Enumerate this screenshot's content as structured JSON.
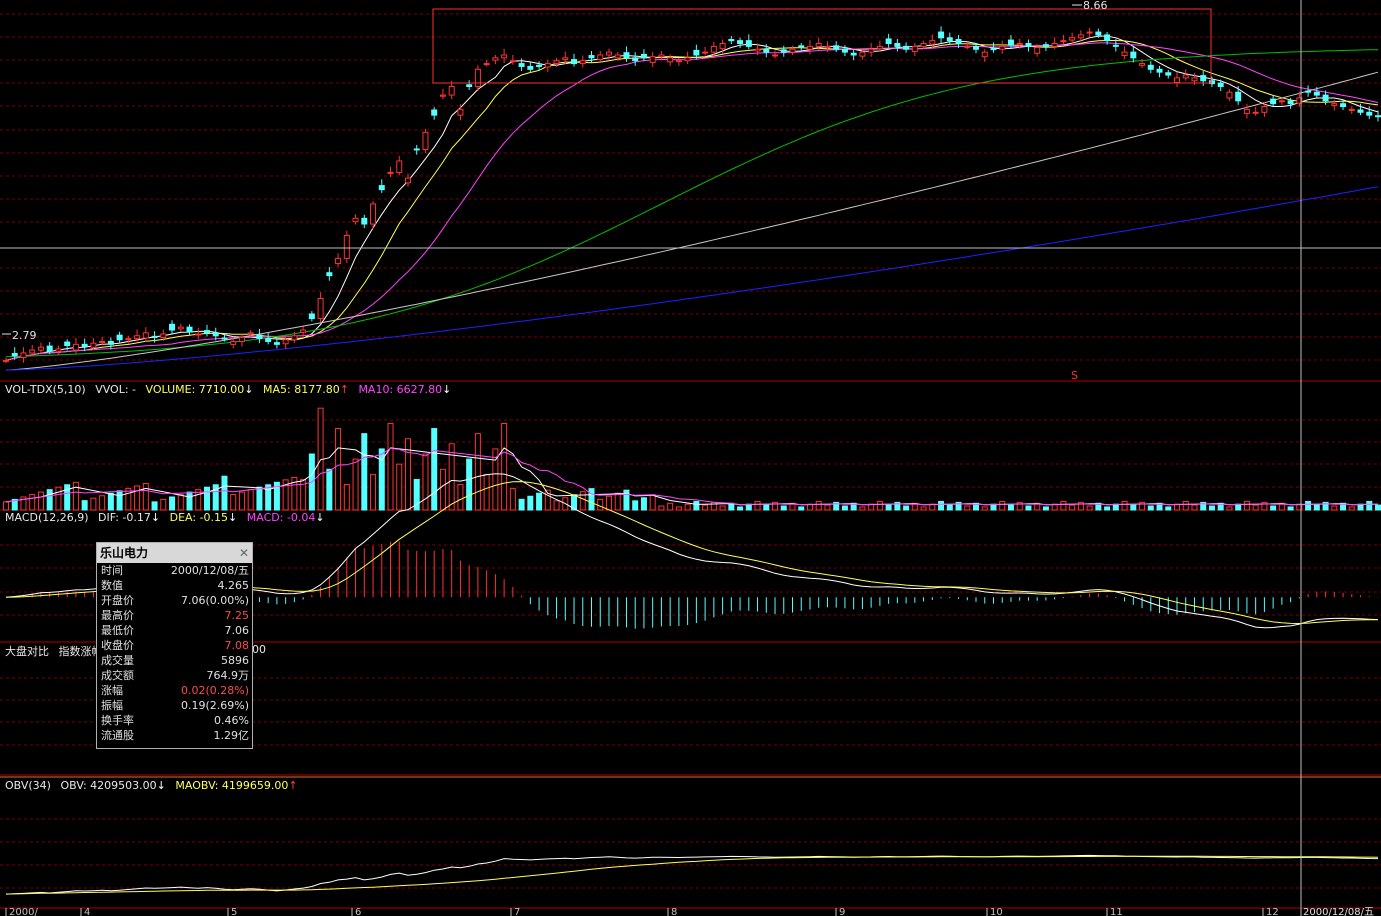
{
  "price_panel": {
    "high_label": "8.66",
    "low_label": "2.79",
    "signal_mark": "S"
  },
  "volume_header": {
    "name": "VOL-TDX(5,10)",
    "vvol": "VVOL: -",
    "volume": "VOLUME: 7710.00",
    "volume_arrow": "↓",
    "ma5": "MA5: 8177.80",
    "ma5_arrow": "↑",
    "ma10": "MA10: 6627.80",
    "ma10_arrow": "↓"
  },
  "macd_header": {
    "name": "MACD(12,26,9)",
    "dif": "DIF: -0.17",
    "dif_arrow": "↓",
    "dea": "DEA: -0.15",
    "dea_arrow": "↓",
    "macd": "MACD: -0.04",
    "macd_arrow": "↓"
  },
  "compare_header": {
    "name": "大盘对比",
    "sub": "指数涨幅",
    "value_tail": "00"
  },
  "obv_header": {
    "name": "OBV(34)",
    "obv": "OBV: 4209503.00",
    "obv_arrow": "↓",
    "maobv": "MAOBV: 4199659.00",
    "maobv_arrow": "↑"
  },
  "info_panel": {
    "title": "乐山电力",
    "close_icon": "✕",
    "rows": [
      {
        "k": "时间",
        "v": "2000/12/08/五",
        "red": false
      },
      {
        "k": "数值",
        "v": "4.265",
        "red": false
      },
      {
        "k": "开盘价",
        "v": "7.06(0.00%)",
        "red": false
      },
      {
        "k": "最高价",
        "v": "7.25",
        "red": true
      },
      {
        "k": "最低价",
        "v": "7.06",
        "red": false
      },
      {
        "k": "收盘价",
        "v": "7.08",
        "red": true
      },
      {
        "k": "成交量",
        "v": "5896",
        "red": false
      },
      {
        "k": "成交额",
        "v": "764.9万",
        "red": false
      },
      {
        "k": "涨幅",
        "v": "0.02(0.28%)",
        "red": true
      },
      {
        "k": "振幅",
        "v": "0.19(2.69%)",
        "red": false
      },
      {
        "k": "换手率",
        "v": "0.46%",
        "red": false
      },
      {
        "k": "流通股",
        "v": "1.29亿",
        "red": false
      }
    ]
  },
  "x_axis": {
    "months": [
      "2000/",
      "4",
      "5",
      "6",
      "7",
      "8",
      "9",
      "10",
      "11",
      "12"
    ],
    "cursor_date": "2000/12/08/五"
  },
  "colors": {
    "up": "#ff3232",
    "down": "#54ffff",
    "ma5": "#ffffff",
    "ma10": "#ffff54",
    "ma20": "#ff45ff",
    "ma60": "#00c000",
    "ma120": "#c8c8c8",
    "ma250": "#2020ff",
    "grid": "#7a0000",
    "separator": "#b00000"
  },
  "chart_data": {
    "type": "candlestick",
    "y_range_price": [
      2.6,
      8.9
    ],
    "high": 8.66,
    "low": 2.79,
    "closes": [
      2.82,
      2.9,
      2.95,
      3.0,
      3.05,
      2.98,
      3.02,
      3.08,
      3.1,
      3.06,
      3.12,
      3.15,
      3.1,
      3.18,
      3.2,
      3.25,
      3.3,
      3.22,
      3.28,
      3.35,
      3.4,
      3.32,
      3.28,
      3.3,
      3.25,
      3.2,
      3.15,
      3.22,
      3.3,
      3.2,
      3.15,
      3.1,
      3.18,
      3.25,
      3.35,
      3.55,
      3.9,
      4.3,
      4.6,
      5.0,
      5.3,
      5.2,
      5.55,
      5.8,
      6.1,
      6.3,
      6.0,
      6.5,
      6.8,
      7.1,
      7.45,
      7.6,
      7.2,
      7.6,
      7.9,
      8.0,
      8.1,
      8.15,
      8.05,
      7.95,
      7.9,
      7.95,
      8.0,
      8.05,
      8.1,
      8.0,
      8.05,
      8.1,
      8.15,
      8.2,
      8.15,
      8.1,
      8.05,
      8.1,
      8.12,
      8.15,
      8.1,
      8.05,
      8.1,
      8.15,
      8.2,
      8.3,
      8.35,
      8.4,
      8.35,
      8.3,
      8.25,
      8.2,
      8.15,
      8.2,
      8.25,
      8.3,
      8.3,
      8.35,
      8.3,
      8.25,
      8.2,
      8.15,
      8.2,
      8.25,
      8.3,
      8.35,
      8.3,
      8.25,
      8.3,
      8.35,
      8.4,
      8.45,
      8.4,
      8.35,
      8.3,
      8.25,
      8.2,
      8.25,
      8.3,
      8.32,
      8.35,
      8.3,
      8.28,
      8.3,
      8.35,
      8.4,
      8.45,
      8.5,
      8.55,
      8.5,
      8.4,
      8.3,
      8.2,
      8.1,
      8.0,
      7.9,
      7.85,
      7.8,
      7.75,
      7.8,
      7.75,
      7.7,
      7.65,
      7.6,
      7.5,
      7.35,
      7.2,
      7.15,
      7.25,
      7.3,
      7.35,
      7.3,
      7.4,
      7.5,
      7.45,
      7.35,
      7.3,
      7.25,
      7.2,
      7.15,
      7.1,
      7.08
    ],
    "volume_range": [
      0,
      110000
    ],
    "macd_range": [
      -0.3,
      0.65
    ],
    "obv_range": [
      0,
      5000000
    ]
  }
}
